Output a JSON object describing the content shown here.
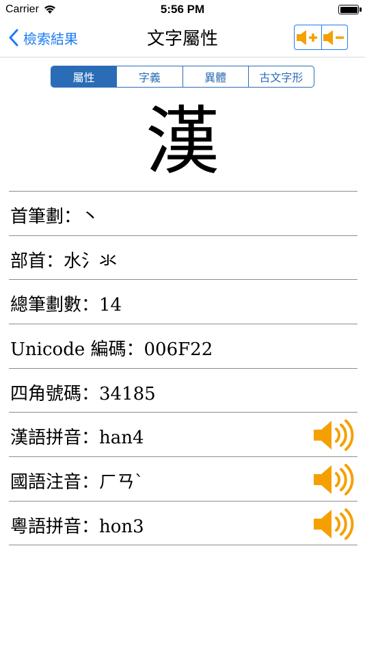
{
  "status_bar": {
    "carrier": "Carrier",
    "time": "5:56 PM"
  },
  "nav": {
    "back_label": "檢索結果",
    "title": "文字屬性",
    "accent_color": "#1a7cf5",
    "volume_icon_color": "#f5a000"
  },
  "segments": [
    {
      "label": "屬性",
      "selected": true
    },
    {
      "label": "字義",
      "selected": false
    },
    {
      "label": "異體",
      "selected": false
    },
    {
      "label": "古文字形",
      "selected": false
    }
  ],
  "character": "漢",
  "properties": [
    {
      "text": "首筆劃：丶",
      "has_audio": false
    },
    {
      "text": "部首：水氵氺",
      "has_audio": false
    },
    {
      "text": "總筆劃數：14",
      "has_audio": false
    },
    {
      "text": "Unicode 編碼：006F22",
      "has_audio": false
    },
    {
      "text": "四角號碼：34185",
      "has_audio": false
    },
    {
      "text": "漢語拼音：han4",
      "has_audio": true
    },
    {
      "text": "國語注音：ㄏㄢˋ",
      "has_audio": true
    },
    {
      "text": "粵語拼音：hon3",
      "has_audio": true
    }
  ],
  "icons": {
    "back": "chevron-left-icon",
    "volume_up": "volume-up-icon",
    "volume_down": "volume-down-icon",
    "speaker": "speaker-icon"
  }
}
